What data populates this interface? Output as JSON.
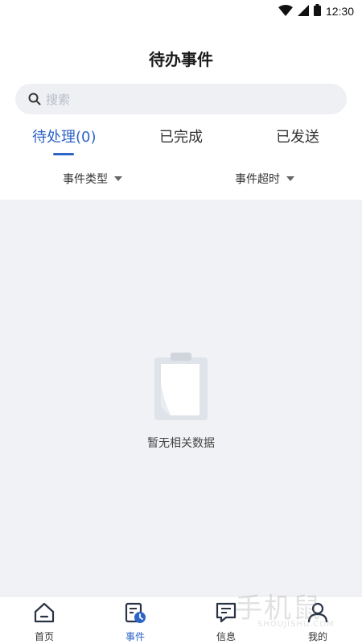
{
  "status_bar": {
    "time": "12:30"
  },
  "header": {
    "title": "待办事件"
  },
  "search": {
    "placeholder": "搜索"
  },
  "tabs": [
    {
      "label": "待处理(0)",
      "active": true
    },
    {
      "label": "已完成",
      "active": false
    },
    {
      "label": "已发送",
      "active": false
    }
  ],
  "filters": {
    "type_label": "事件类型",
    "timeout_label": "事件超时"
  },
  "empty_state": {
    "message": "暂无相关数据",
    "icon": "clipboard-icon"
  },
  "bottom_nav": [
    {
      "label": "首页",
      "icon": "home-icon",
      "active": false
    },
    {
      "label": "事件",
      "icon": "event-icon",
      "active": true
    },
    {
      "label": "信息",
      "icon": "message-icon",
      "active": false
    },
    {
      "label": "我的",
      "icon": "person-icon",
      "active": false
    }
  ],
  "watermark": {
    "text": "手机鼠",
    "subtext": "SHOUJISHU.COM"
  },
  "colors": {
    "accent": "#2d64c8",
    "background": "#f1f2f5",
    "search_bg": "#eef0f4"
  }
}
